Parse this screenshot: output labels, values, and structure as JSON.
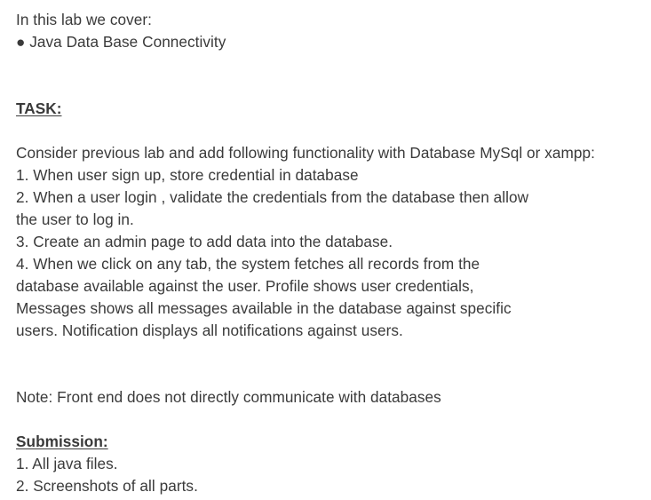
{
  "intro": {
    "line": "In this lab we cover:",
    "bullet": "● Java Data Base Connectivity"
  },
  "task": {
    "heading": "TASK:",
    "intro": "Consider previous lab and add following functionality with Database MySql or xampp:",
    "item1": "1. When user sign up, store credential in database",
    "item2_line1": "2. When a user login , validate the credentials from the database then allow",
    "item2_line2": "the user to log in.",
    "item3": "3. Create an admin page to add data into the database.",
    "item4_line1": "4. When we click on any tab, the system fetches all records from the",
    "item4_line2": "database available against the user. Profile shows user credentials,",
    "item4_line3": "Messages shows all messages available in the database against specific",
    "item4_line4": "users. Notification displays all notifications against users."
  },
  "note": "Note: Front end does not directly communicate with databases",
  "submission": {
    "heading": "Submission:",
    "item1": "1. All java files.",
    "item2": "2. Screenshots of all parts."
  }
}
